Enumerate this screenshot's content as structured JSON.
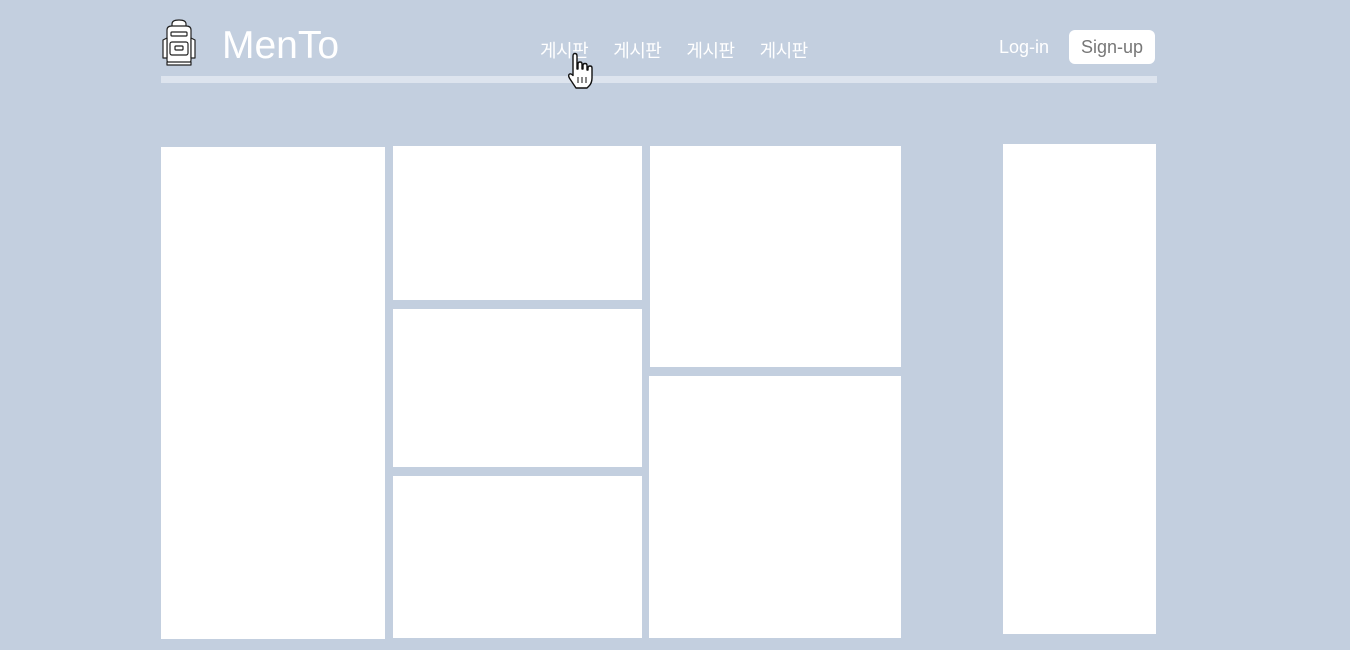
{
  "header": {
    "logo_icon": "backpack-icon",
    "brand": "MenTo",
    "nav": [
      {
        "label": "게시판"
      },
      {
        "label": "게시판"
      },
      {
        "label": "게시판"
      },
      {
        "label": "게시판"
      }
    ],
    "login_label": "Log-in",
    "signup_label": "Sign-up"
  },
  "colors": {
    "background": "#c3cfdf",
    "card": "#ffffff",
    "divider": "#dde4ee",
    "header_text": "#ffffff",
    "signup_text": "#777777"
  },
  "cursor_icon": "hand-pointer-icon"
}
